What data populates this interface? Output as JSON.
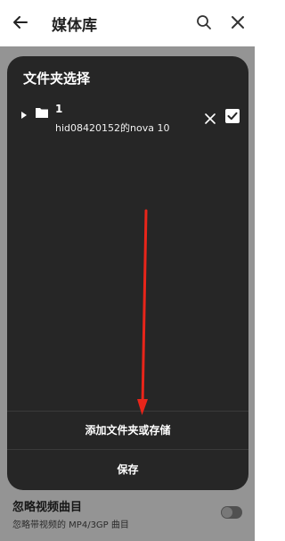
{
  "appbar": {
    "title": "媒体库",
    "back_icon": "arrow-left-icon",
    "search_icon": "search-icon",
    "close_icon": "close-icon"
  },
  "background_setting": {
    "title": "忽略视频曲目",
    "subtitle": "忽略带视频的 MP4/3GP 曲目",
    "enabled": false
  },
  "dialog": {
    "title": "文件夹选择",
    "folders": [
      {
        "name": "1",
        "path": "hid08420152的nova 10",
        "checked": true
      }
    ],
    "add_label": "添加文件夹或存储",
    "save_label": "保存"
  },
  "colors": {
    "dialog_bg": "#262626",
    "annotation_arrow": "#e8251a"
  }
}
